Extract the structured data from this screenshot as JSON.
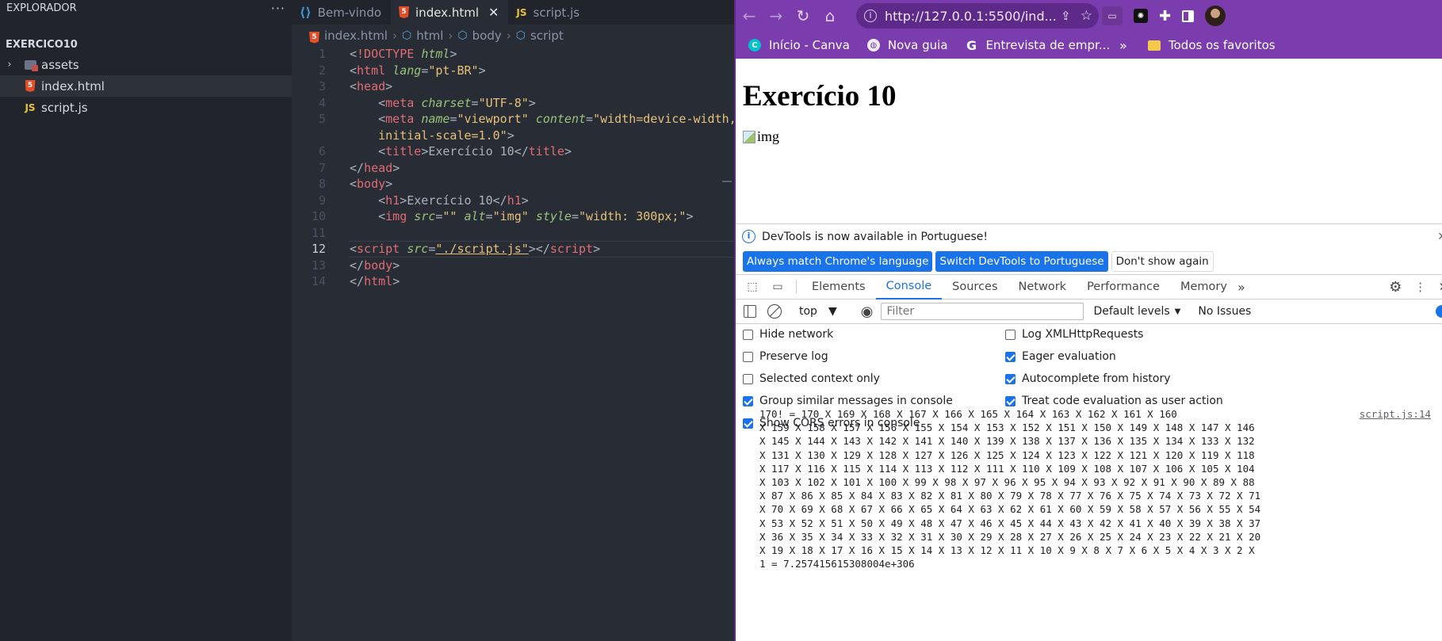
{
  "vscode": {
    "explorer_title": "EXPLORADOR",
    "folder_name": "EXERCICO10",
    "files": [
      {
        "name": "assets",
        "type": "folder"
      },
      {
        "name": "index.html",
        "type": "html"
      },
      {
        "name": "script.js",
        "type": "js"
      }
    ],
    "tabs": [
      {
        "label": "Bem-vindo",
        "icon": "vscode-icon"
      },
      {
        "label": "index.html",
        "icon": "html5-icon"
      },
      {
        "label": "script.js",
        "icon": "js-icon"
      }
    ],
    "breadcrumb": [
      "index.html",
      "html",
      "body",
      "script"
    ],
    "line_numbers": [
      "1",
      "2",
      "3",
      "4",
      "5",
      "",
      "6",
      "7",
      "8",
      "9",
      "10",
      "11",
      "12",
      "13",
      "14"
    ],
    "code": {
      "l1_tag": "!DOCTYPE",
      "l1_attr": "html",
      "l2_tag": "html",
      "l2_attr": "lang",
      "l2_val": "\"pt-BR\"",
      "l3_tag": "head",
      "l4_tag": "meta",
      "l4_attr": "charset",
      "l4_val": "\"UTF-8\"",
      "l5_tag": "meta",
      "l5_attr1": "name",
      "l5_val1": "\"viewport\"",
      "l5_attr2": "content",
      "l5_val2a": "\"width=device-width,",
      "l5_val2b": "initial-scale=1.0\"",
      "l6_tag": "title",
      "l6_text": "Exercício 10",
      "l7_tag": "head",
      "l8_tag": "body",
      "l9_tag": "h1",
      "l9_text": "Exercício 10",
      "l10_tag": "img",
      "l10_attr1": "src",
      "l10_val1": "\"\"",
      "l10_attr2": "alt",
      "l10_val2": "\"img\"",
      "l10_attr3": "style",
      "l10_val3": "\"width: 300px;\"",
      "l12_tag": "script",
      "l12_attr": "src",
      "l12_val": "\"./script.js\"",
      "l13_tag": "body",
      "l14_tag": "html"
    }
  },
  "chrome": {
    "url": "http://127.0.0.1:5500/ind...",
    "bookmarks": [
      {
        "label": "Início - Canva",
        "icon": "canva-icon"
      },
      {
        "label": "Nova guia",
        "icon": "globe-icon"
      },
      {
        "label": "Entrevista de empr...",
        "icon": "gupy-icon"
      }
    ],
    "bookmarks_more": "»",
    "all_bookmarks": "Todos os favoritos",
    "page": {
      "heading": "Exercício 10",
      "img_alt": "img"
    },
    "devtools": {
      "banner": "DevTools is now available in Portuguese!",
      "btn_match": "Always match Chrome's language",
      "btn_switch": "Switch DevTools to Portuguese",
      "btn_dont": "Don't show again",
      "tabs": [
        "Elements",
        "Console",
        "Sources",
        "Network",
        "Performance",
        "Memory"
      ],
      "active_tab": "Console",
      "context": "top",
      "filter_placeholder": "Filter",
      "levels": "Default levels",
      "issues": "No Issues",
      "settings_left": [
        {
          "label": "Hide network",
          "checked": false
        },
        {
          "label": "Preserve log",
          "checked": false
        },
        {
          "label": "Selected context only",
          "checked": false
        },
        {
          "label": "Group similar messages in console",
          "checked": true
        },
        {
          "label": "Show CORS errors in console",
          "checked": true
        }
      ],
      "settings_right": [
        {
          "label": "Log XMLHttpRequests",
          "checked": false
        },
        {
          "label": "Eager evaluation",
          "checked": true
        },
        {
          "label": "Autocomplete from history",
          "checked": true
        },
        {
          "label": "Treat code evaluation as user action",
          "checked": true
        }
      ],
      "console_source": "script.js:14",
      "console_lines": [
        "170! = 170 X 169 X 168 X 167 X 166 X 165 X 164 X 163 X 162 X 161 X 160",
        "X 159 X 158 X 157 X 156 X 155 X 154 X 153 X 152 X 151 X 150 X 149 X 148 X 147 X 146",
        "X 145 X 144 X 143 X 142 X 141 X 140 X 139 X 138 X 137 X 136 X 135 X 134 X 133 X 132",
        "X 131 X 130 X 129 X 128 X 127 X 126 X 125 X 124 X 123 X 122 X 121 X 120 X 119 X 118",
        "X 117 X 116 X 115 X 114 X 113 X 112 X 111 X 110 X 109 X 108 X 107 X 106 X 105 X 104",
        "X 103 X 102 X 101 X 100 X 99 X 98 X 97 X 96 X 95 X 94 X 93 X 92 X 91 X 90 X 89 X 88",
        "X 87 X 86 X 85 X 84 X 83 X 82 X 81 X 80 X 79 X 78 X 77 X 76 X 75 X 74 X 73 X 72 X 71",
        "X 70 X 69 X 68 X 67 X 66 X 65 X 64 X 63 X 62 X 61 X 60 X 59 X 58 X 57 X 56 X 55 X 54",
        "X 53 X 52 X 51 X 50 X 49 X 48 X 47 X 46 X 45 X 44 X 43 X 42 X 41 X 40 X 39 X 38 X 37",
        "X 36 X 35 X 34 X 33 X 32 X 31 X 30 X 29 X 28 X 27 X 26 X 25 X 24 X 23 X 22 X 21 X 20",
        "X 19 X 18 X 17 X 16 X 15 X 14 X 13 X 12 X 11 X 10 X 9 X 8 X 7 X 6 X 5 X 4 X 3 X 2 X",
        "1 = 7.257415615308004e+306"
      ]
    }
  },
  "colors": {
    "chrome_theme": "#7b3cae",
    "devtools_accent": "#1a73e8",
    "editor_bg": "#282c34"
  }
}
